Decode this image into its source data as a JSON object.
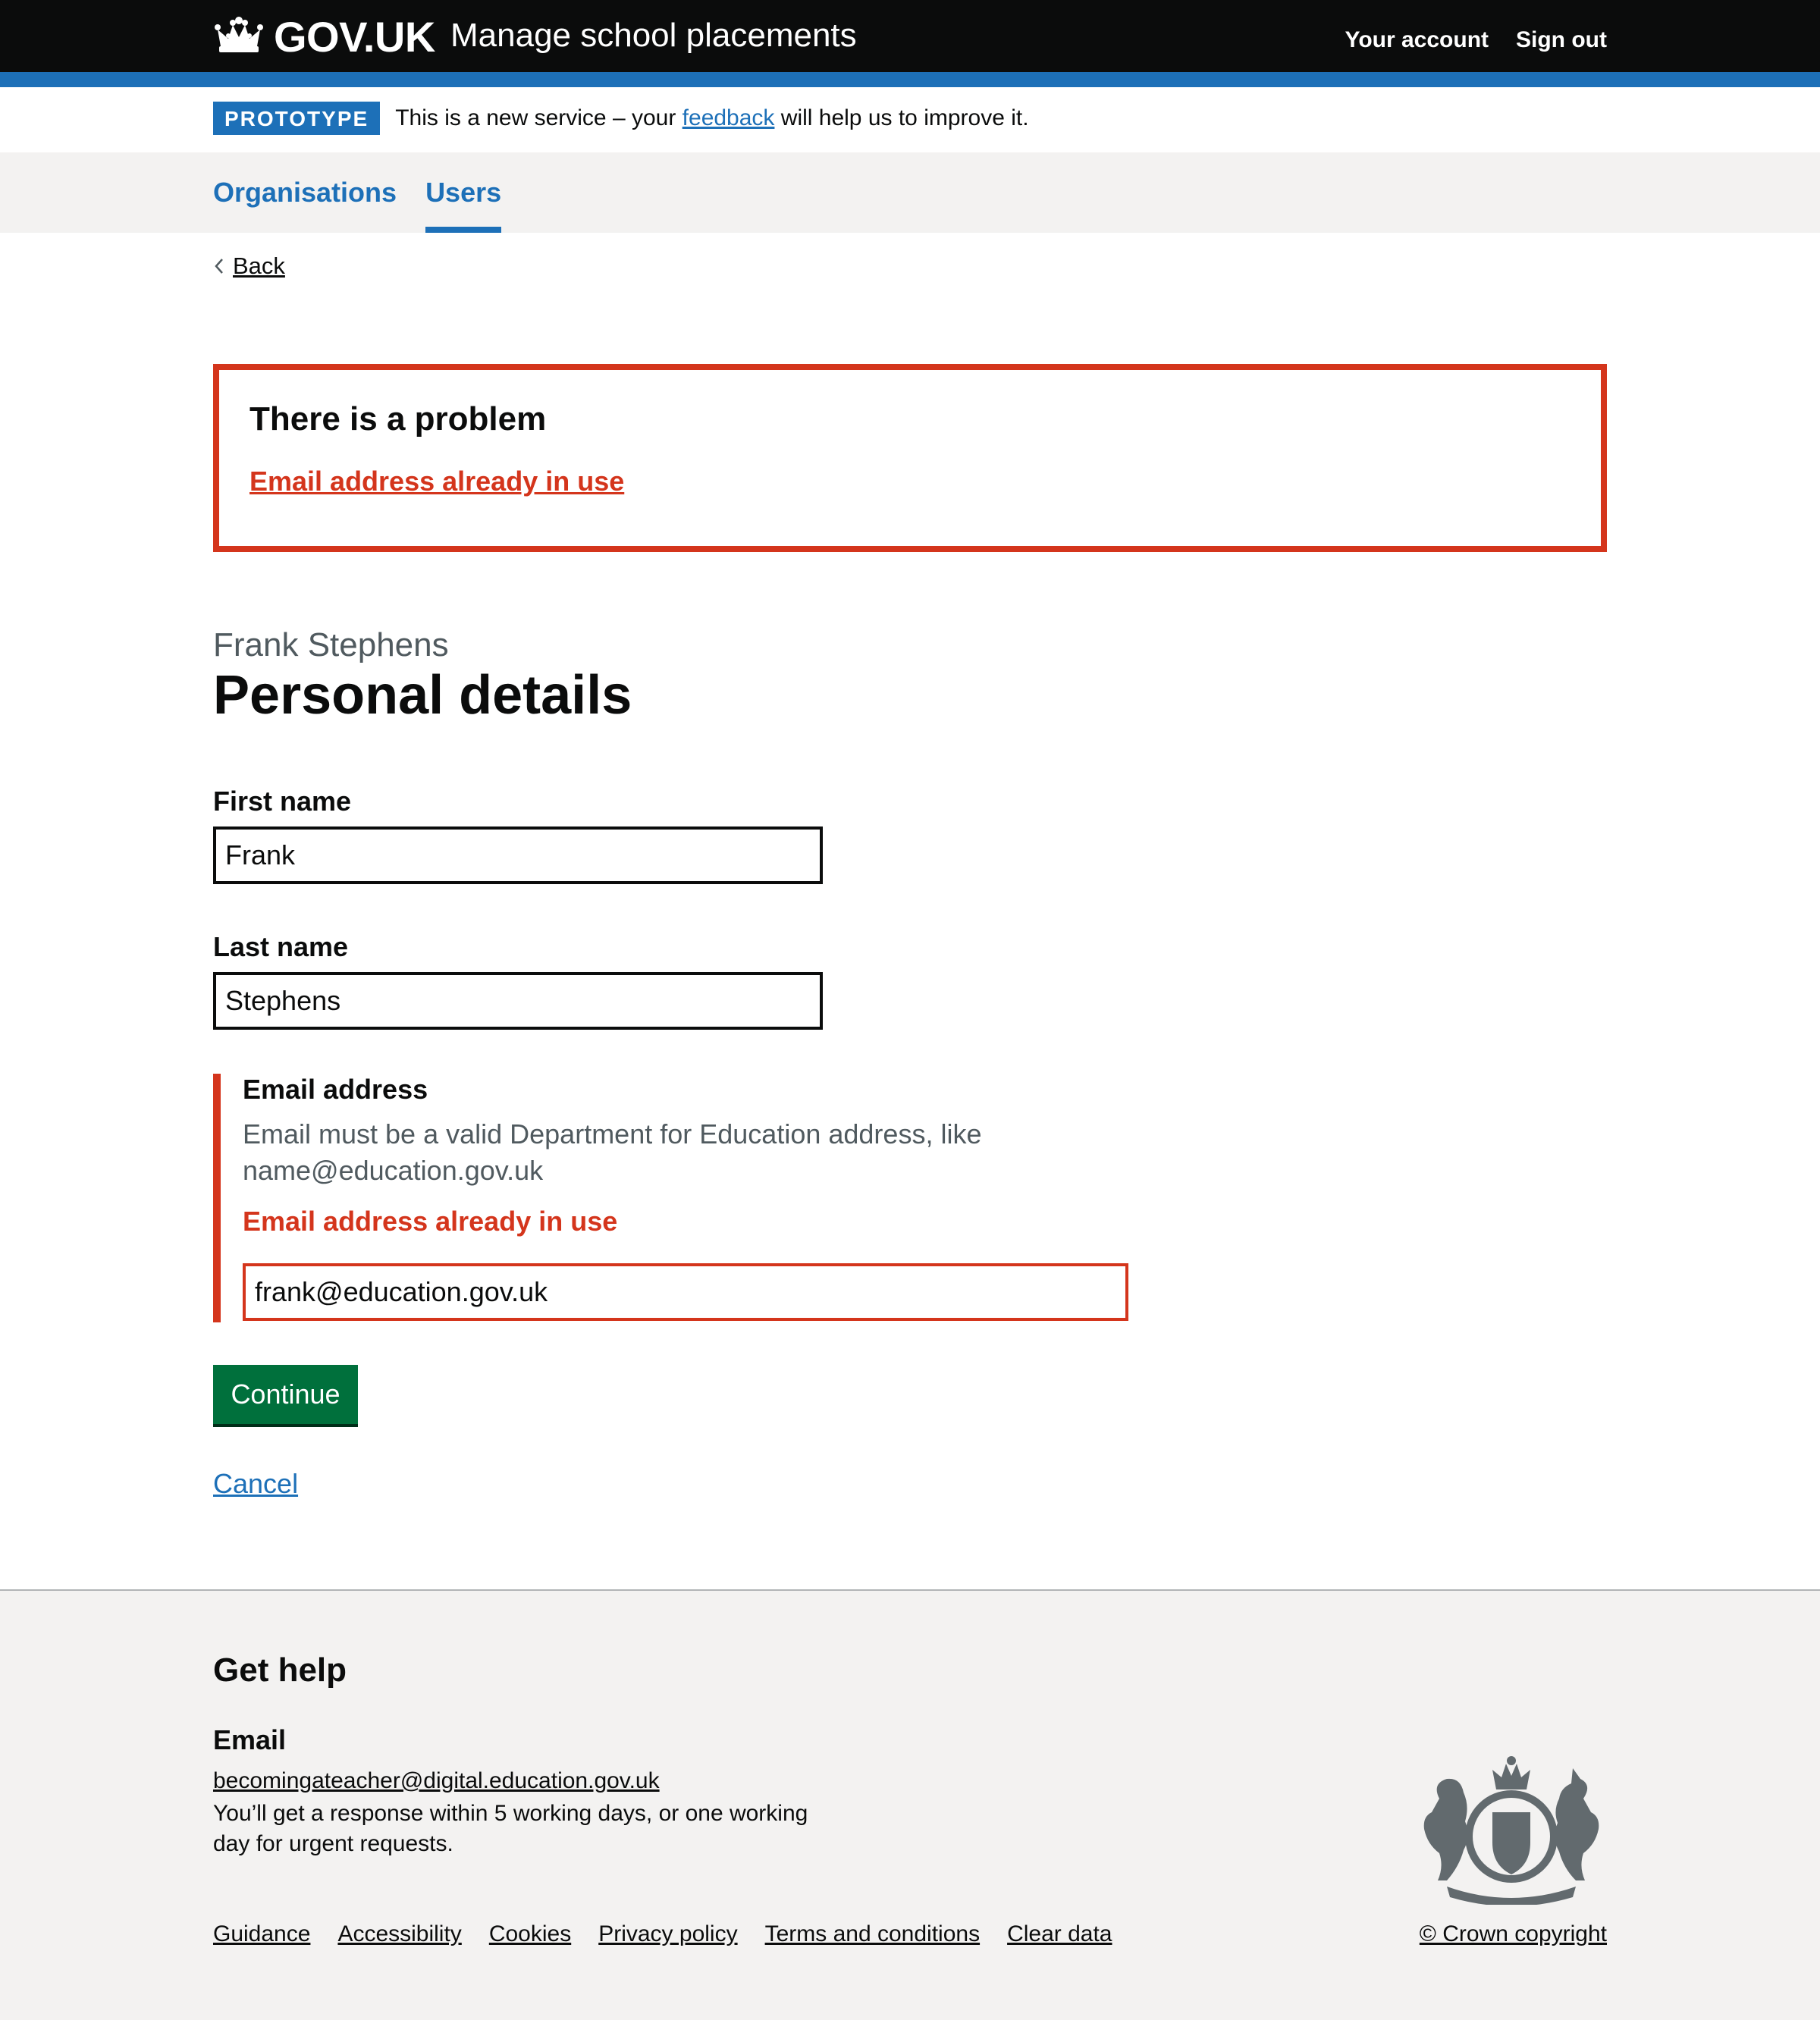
{
  "header": {
    "logo_text": "GOV.UK",
    "service_name": "Manage school placements",
    "nav": [
      "Your account",
      "Sign out"
    ]
  },
  "phase_banner": {
    "tag": "PROTOTYPE",
    "text_before": "This is a new service – your ",
    "link": "feedback",
    "text_after": " will help us to improve it."
  },
  "primary_nav": {
    "items": [
      "Organisations",
      "Users"
    ],
    "active": "Users"
  },
  "back_link": "Back",
  "error_summary": {
    "title": "There is a problem",
    "errors": [
      "Email address already in use"
    ]
  },
  "page": {
    "caption": "Frank Stephens",
    "title": "Personal details"
  },
  "form": {
    "first_name": {
      "label": "First name",
      "value": "Frank"
    },
    "last_name": {
      "label": "Last name",
      "value": "Stephens"
    },
    "email": {
      "label": "Email address",
      "hint": "Email must be a valid Department for Education address, like name@education.gov.uk",
      "error": "Email address already in use",
      "value": "frank@education.gov.uk"
    },
    "submit": "Continue",
    "cancel": "Cancel"
  },
  "footer": {
    "help_title": "Get help",
    "email_label": "Email",
    "email": "becomingateacher@digital.education.gov.uk",
    "response_text": "You’ll get a response within 5 working days, or one working day for urgent requests.",
    "links": [
      "Guidance",
      "Accessibility",
      "Cookies",
      "Privacy policy",
      "Terms and conditions",
      "Clear data"
    ],
    "copyright": "© Crown copyright"
  },
  "colors": {
    "header_bg": "#0b0c0c",
    "brand_blue": "#1d70b8",
    "error_red": "#d4351c",
    "button_green": "#00703c",
    "footer_bg": "#f3f2f1"
  }
}
